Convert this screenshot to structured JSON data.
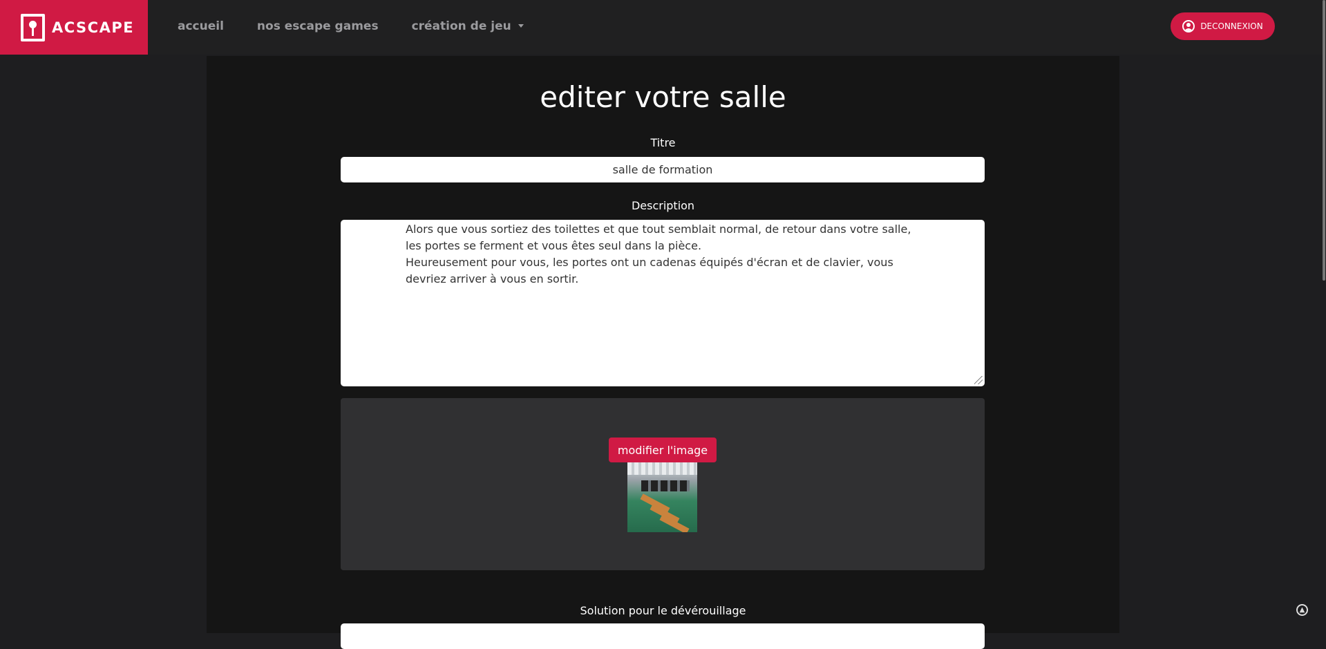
{
  "brand": {
    "name": "ACSCAPE"
  },
  "nav": {
    "links": [
      "accueil",
      "nos escape games",
      "création de jeu"
    ],
    "logout_label": "DECONNEXION"
  },
  "page": {
    "title": "editer votre salle"
  },
  "form": {
    "title_label": "Titre",
    "title_value": "salle de formation",
    "description_label": "Description",
    "description_value": "Alors que vous sortiez des toilettes et que tout semblait normal, de retour dans votre salle, les portes se ferment et vous êtes seul dans la pièce.\nHeureusement pour vous, les portes ont un cadenas équipés d'écran et de clavier, vous devriez arriver à vous en sortir.",
    "image_button_label": "modifier l'image",
    "solution_label": "Solution pour le dévérouillage"
  },
  "colors": {
    "accent": "#d01a44",
    "navbar": "#202021",
    "background": "#1e1e20",
    "container": "#151515",
    "panel": "#303032"
  },
  "icons": [
    "keyhole-logo-icon",
    "dropdown-caret-icon",
    "user-circle-icon",
    "scroll-top-icon"
  ]
}
